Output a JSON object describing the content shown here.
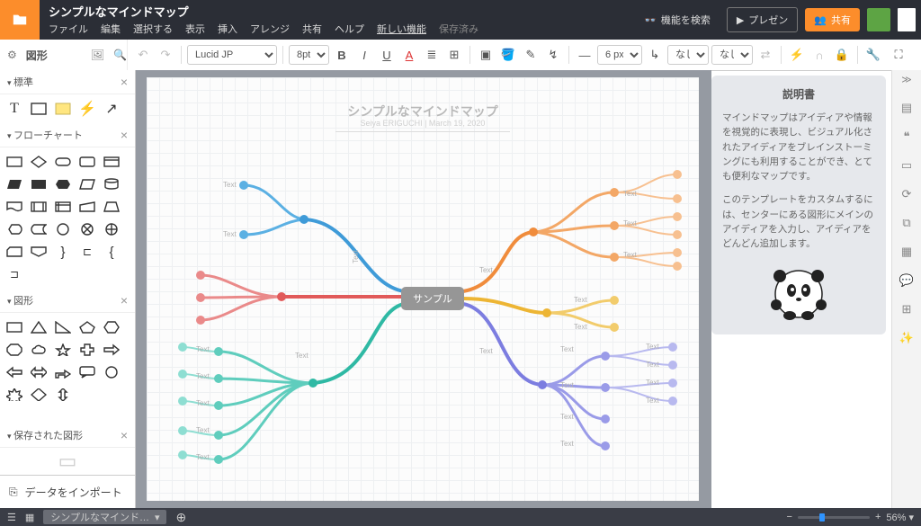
{
  "header": {
    "title": "シンプルなマインドマップ",
    "menus": [
      "ファイル",
      "編集",
      "選択する",
      "表示",
      "挿入",
      "アレンジ",
      "共有",
      "ヘルプ"
    ],
    "new_feature": "新しい機能",
    "saved": "保存済み",
    "search_features": "機能を検索",
    "present": "プレゼン",
    "share": "共有"
  },
  "toolbar": {
    "shapes_label": "図形",
    "font": "Lucid JP",
    "font_size": "8pt ▾",
    "line_px": "6 px ▾",
    "none1": "なし ▾",
    "none2": "なし ▾"
  },
  "left_panel": {
    "sec_standard": "標準",
    "sec_flowchart": "フローチャート",
    "sec_shapes": "図形",
    "sec_saved": "保存された図形",
    "import": "データをインポート"
  },
  "canvas": {
    "doc_title": "シンプルなマインドマップ",
    "doc_sub": "Seiya ERIGUCHI  |  March 19, 2020",
    "center_label": "サンプル",
    "node_label": "Text"
  },
  "info": {
    "title": "説明書",
    "p1": "マインドマップはアイディアや情報を視覚的に表現し、ビジュアル化されたアイディアをブレインストーミングにも利用することができ、とても便利なマップです。",
    "p2": "このテンプレートをカスタムするには、センターにある図形にメインのアイディアを入力し、アイディアをどんどん追加します。"
  },
  "bottom": {
    "tab": "シンプルなマインド…",
    "zoom": "56%"
  }
}
